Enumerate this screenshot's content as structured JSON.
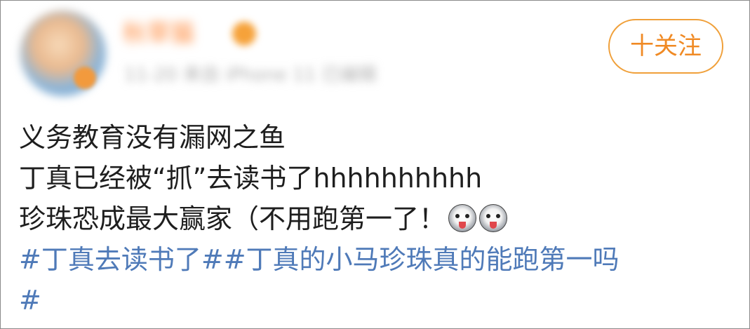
{
  "header": {
    "username": "秋草猫",
    "meta": "11-20  来自 iPhone 11  已编辑",
    "follow_label": "十关注"
  },
  "post": {
    "lines": [
      "义务教育没有漏网之鱼",
      "丁真已经被“抓”去读书了hhhhhhhhhh",
      "珍珠恐成最大赢家（不用跑第一了！"
    ],
    "emojis": [
      "husky-emoji",
      "husky-emoji"
    ],
    "topics": [
      "#丁真去读书了#",
      "#丁真的小马珍珠真的能跑第一吗",
      "#"
    ]
  },
  "colors": {
    "text": "#1e1e1e",
    "topic": "#4f7ab8",
    "follow": "#f08a24",
    "border": "#8a8a8a"
  }
}
